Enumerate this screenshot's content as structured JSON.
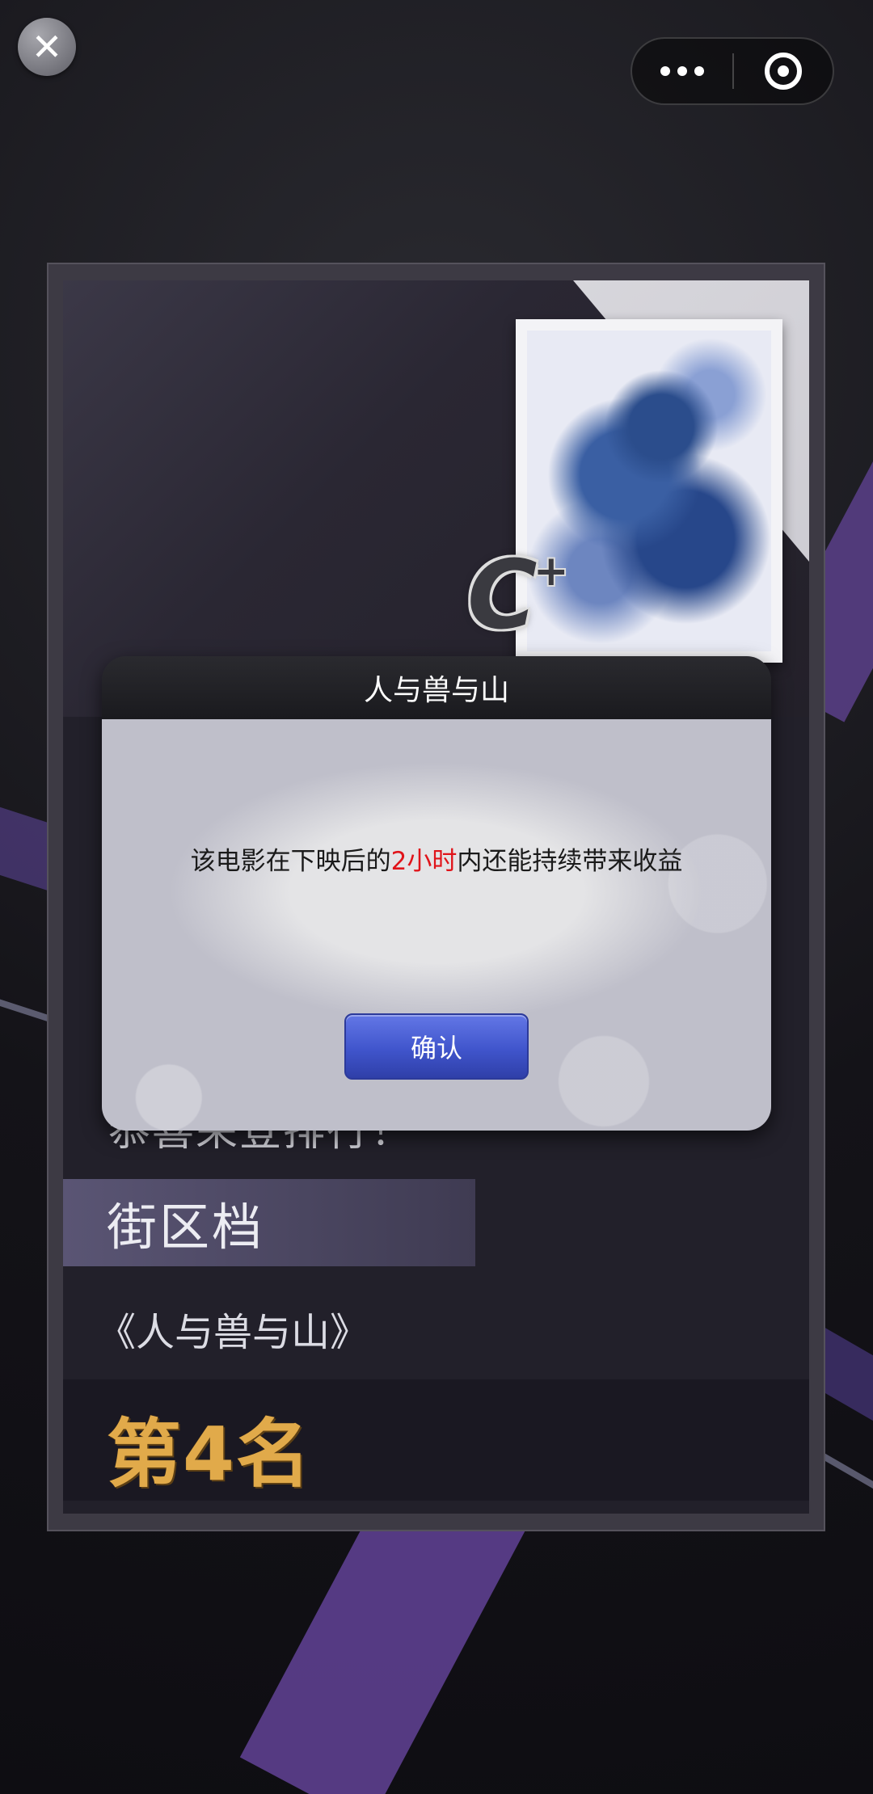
{
  "top_bar": {
    "close_icon": "close-icon",
    "more_icon": "more-dots-icon",
    "target_icon": "target-icon"
  },
  "card": {
    "grade": "C",
    "grade_plus": "+",
    "congrats": "恭喜荣登排行！",
    "category": "街区档",
    "film_title": "《人与兽与山》",
    "rank": "第4名"
  },
  "modal": {
    "title": "人与兽与山",
    "message_prefix": "该电影在下映后的",
    "message_highlight": "2小时",
    "message_suffix": "内还能持续带来收益",
    "confirm_label": "确认"
  },
  "colors": {
    "highlight": "#e0141a",
    "rank_gold": "#e1aa4a",
    "confirm_blue": "#4055cc"
  }
}
